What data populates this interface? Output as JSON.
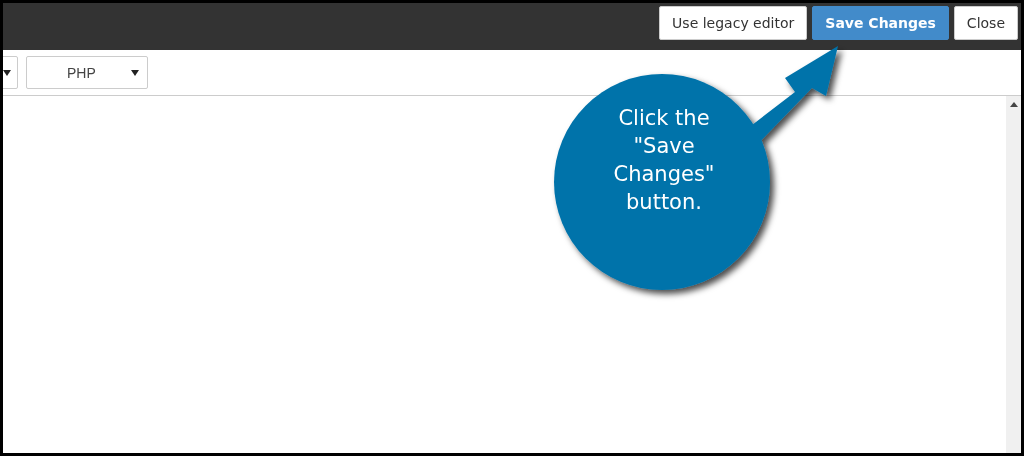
{
  "header_buttons": [
    {
      "label": "Use legacy editor",
      "kind": "secondary"
    },
    {
      "label": "Save Changes",
      "kind": "primary"
    },
    {
      "label": "Close",
      "kind": "secondary"
    }
  ],
  "language_dropdown": {
    "value": "PHP"
  },
  "callout": {
    "text": "Click the \"Save Changes\" button."
  }
}
